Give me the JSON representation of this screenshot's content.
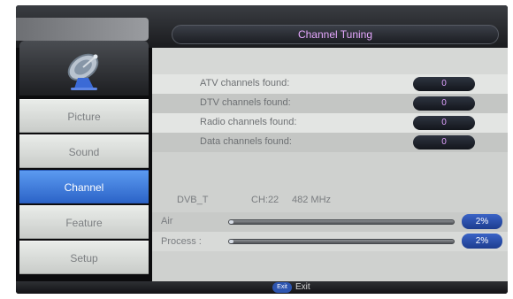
{
  "title": "Channel Tuning",
  "menu": {
    "items": [
      {
        "label": "Picture",
        "active": false
      },
      {
        "label": "Sound",
        "active": false
      },
      {
        "label": "Channel",
        "active": true
      },
      {
        "label": "Feature",
        "active": false
      },
      {
        "label": "Setup",
        "active": false
      }
    ]
  },
  "counts": [
    {
      "label": "ATV channels found:",
      "value": "0"
    },
    {
      "label": "DTV channels found:",
      "value": "0"
    },
    {
      "label": "Radio channels found:",
      "value": "0"
    },
    {
      "label": "Data channels found:",
      "value": "0"
    }
  ],
  "signal": {
    "type": "DVB_T",
    "channel": "CH:22",
    "frequency": "482 MHz"
  },
  "progress": {
    "air": {
      "label": "Air",
      "percent_text": "2%",
      "value": 0.02
    },
    "process": {
      "label": "Process :",
      "percent_text": "2%",
      "value": 0.02
    }
  },
  "footer": {
    "exit_badge": "Exit",
    "exit_label": "Exit"
  },
  "colors": {
    "accent_blue": "#2c64c8",
    "title_text": "#e6a8ff",
    "panel_bg": "#cfd1cf"
  },
  "icons": {
    "logo": "satellite-dish-icon"
  }
}
